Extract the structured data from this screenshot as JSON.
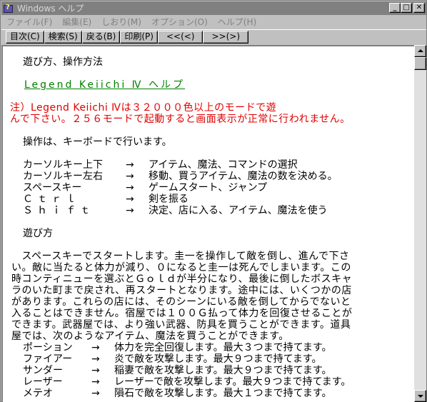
{
  "window": {
    "title": "Windows ヘルプ",
    "minimize_glyph": "_",
    "maximize_glyph": "□",
    "close_glyph": "✕"
  },
  "menu": [
    "ファイル(F)",
    "編集(E)",
    "しおり(M)",
    "オプション(O)",
    "ヘルプ(H)"
  ],
  "toolbar": [
    "目次(C)",
    "検索(S)",
    "戻る(B)",
    "印刷(P)",
    "<<(<)",
    ">>(>)"
  ],
  "content": {
    "heading": "遊び方、操作方法",
    "link": "Legend Keiichi Ⅳ ヘルプ",
    "note_line1": "注）Legend Keiichi Ⅳは３２０００色以上のモードで遊",
    "note_line2": "んで下さい。２５６モードで起動すると画面表示が正常に行われません。",
    "controls_intro": "操作は、キーボードで行います。",
    "controls": [
      {
        "key": "カーソルキー上下",
        "arrow": "→",
        "desc": "アイテム、魔法、コマンドの選択"
      },
      {
        "key": "カーソルキー左右",
        "arrow": "→",
        "desc": "移動、買うアイテム、魔法の数を決める。"
      },
      {
        "key": "スペースキー",
        "arrow": "→",
        "desc": "ゲームスタート、ジャンプ"
      },
      {
        "key": "Ｃｔｒｌ",
        "arrow": "→",
        "desc": "剣を振る"
      },
      {
        "key": "Ｓｈｉｆｔ",
        "arrow": "→",
        "desc": "決定、店に入る、アイテム、魔法を使う"
      }
    ],
    "section_title": "遊び方",
    "paragraph": [
      "　スペースキーでスタートします。圭一を操作して敵を倒し、進んで下さ",
      "い。敵に当たると体力が減り、０になると圭一は死んでしまいます。この",
      "時コンティニューを選ぶとＧｏｌｄが半分になり、最後に倒したボスキャ",
      "ラのいた町まで戻され、再スタートとなります。途中には、いくつかの店",
      "があります。これらの店には、そのシーンにいる敵を倒してからでないと",
      "入ることはできません。宿屋では１００Ｇ払って体力を回復させることが",
      "できます。武器屋では、より強い武器、防具を買うことができます。道具",
      "屋では、次のようなアイテム、魔法を買うことができます。"
    ],
    "items": [
      {
        "name": "ポーション",
        "arrow": "→",
        "desc": "体力を完全回復します。最大３つまで持てます。"
      },
      {
        "name": "ファイアー",
        "arrow": "→",
        "desc": "炎で敵を攻撃します。最大９つまで持てます。"
      },
      {
        "name": "サンダー",
        "arrow": "→",
        "desc": "稲妻で敵を攻撃します。最大９つまで持てます。"
      },
      {
        "name": "レーザー",
        "arrow": "→",
        "desc": "レーザーで敵を攻撃します。最大９つまで持てます。"
      },
      {
        "name": "メテオ",
        "arrow": "→",
        "desc": "隕石で敵を攻撃します。最大１つまで持てます。"
      }
    ]
  }
}
